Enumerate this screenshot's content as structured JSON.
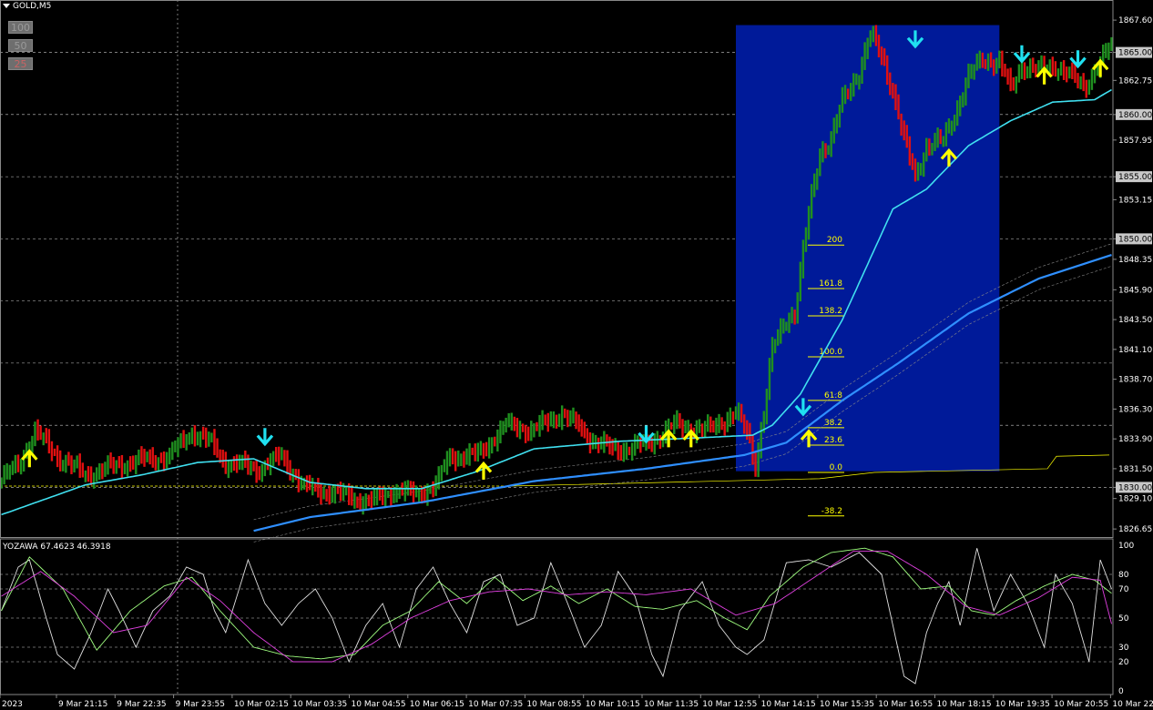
{
  "symbol_label": "GOLD,M5",
  "zoom_buttons": [
    {
      "label": "100",
      "color": "#9a9a9a",
      "bg": "#6e6e6e"
    },
    {
      "label": "50",
      "color": "#9a9a9a",
      "bg": "#6e6e6e"
    },
    {
      "label": "25",
      "color": "#c86464",
      "bg": "#6e6e6e"
    }
  ],
  "colors": {
    "background": "#000000",
    "bull": "#1f8f1f",
    "bear": "#e01010",
    "ma_fast": "#40e0f0",
    "ma_slow": "#2f8fff",
    "fib_box": "#001a99",
    "fib_line": "#ffff00",
    "buy_arrow": "#ffff00",
    "sell_arrow": "#20e0f0",
    "grid": "#c8c8c8"
  },
  "chart_data": [
    {
      "type": "candlestick",
      "symbol": "GOLD",
      "timeframe": "M5",
      "ylim": [
        1826.0,
        1869.0
      ],
      "price_ticks": [
        "1867.60",
        "1865.00",
        "1862.75",
        "1860.00",
        "1857.95",
        "1855.00",
        "1853.15",
        "1850.00",
        "1848.35",
        "1845.90",
        "1843.50",
        "1841.10",
        "1838.70",
        "1836.30",
        "1833.90",
        "1831.50",
        "1830.00",
        "1829.10",
        "1826.65"
      ],
      "highlighted_levels": [
        "1865.00",
        "1860.00",
        "1855.00",
        "1850.00",
        "1845.00",
        "1840.00",
        "1835.00",
        "1830.00"
      ],
      "time_ticks": [
        "2023",
        "9 Mar 21:15",
        "9 Mar 22:35",
        "9 Mar 23:55",
        "10 Mar 02:15",
        "10 Mar 03:35",
        "10 Mar 04:55",
        "10 Mar 06:15",
        "10 Mar 07:35",
        "10 Mar 08:55",
        "10 Mar 10:15",
        "10 Mar 11:35",
        "10 Mar 12:55",
        "10 Mar 14:15",
        "10 Mar 15:35",
        "10 Mar 16:55",
        "10 Mar 18:15",
        "10 Mar 19:35",
        "10 Mar 20:55",
        "10 Mar 22:15"
      ],
      "price_keypoints": [
        [
          0,
          1830.6
        ],
        [
          6,
          1831.8
        ],
        [
          12,
          1834.5
        ],
        [
          20,
          1832.5
        ],
        [
          30,
          1831.0
        ],
        [
          45,
          1832.0
        ],
        [
          60,
          1832.5
        ],
        [
          68,
          1834.5
        ],
        [
          75,
          1833.5
        ],
        [
          80,
          1832.0
        ],
        [
          92,
          1831.5
        ],
        [
          100,
          1832.5
        ],
        [
          108,
          1830.0
        ],
        [
          118,
          1829.6
        ],
        [
          132,
          1828.8
        ],
        [
          140,
          1829.8
        ],
        [
          148,
          1829.4
        ],
        [
          155,
          1830.2
        ],
        [
          160,
          1832.5
        ],
        [
          170,
          1832.6
        ],
        [
          180,
          1835.0
        ],
        [
          190,
          1834.6
        ],
        [
          200,
          1836.0
        ],
        [
          210,
          1834.0
        ],
        [
          218,
          1833.0
        ],
        [
          230,
          1833.4
        ],
        [
          240,
          1835.0
        ],
        [
          252,
          1834.6
        ],
        [
          262,
          1836.0
        ],
        [
          266,
          1834.4
        ],
        [
          269,
          1831.9
        ],
        [
          272,
          1836.0
        ],
        [
          275,
          1841.0
        ],
        [
          280,
          1843.6
        ],
        [
          283,
          1844.1
        ],
        [
          288,
          1852.0
        ],
        [
          292,
          1857.0
        ],
        [
          296,
          1858.0
        ],
        [
          300,
          1861.0
        ],
        [
          306,
          1863.5
        ],
        [
          310,
          1866.4
        ],
        [
          314,
          1864.7
        ],
        [
          318,
          1862.0
        ],
        [
          322,
          1858.0
        ],
        [
          326,
          1855.0
        ],
        [
          330,
          1857.5
        ],
        [
          336,
          1857.9
        ],
        [
          340,
          1860.0
        ],
        [
          345,
          1863.0
        ],
        [
          350,
          1864.5
        ],
        [
          356,
          1864.2
        ],
        [
          360,
          1862.0
        ],
        [
          364,
          1864.0
        ],
        [
          370,
          1863.5
        ],
        [
          376,
          1864.0
        ],
        [
          382,
          1863.0
        ],
        [
          386,
          1862.2
        ],
        [
          390,
          1863.6
        ],
        [
          396,
          1865.5
        ]
      ],
      "ma_fast_keypoints": [
        [
          0,
          1827.8
        ],
        [
          30,
          1830.2
        ],
        [
          50,
          1831.0
        ],
        [
          70,
          1832.0
        ],
        [
          90,
          1832.3
        ],
        [
          110,
          1830.4
        ],
        [
          130,
          1829.9
        ],
        [
          150,
          1829.9
        ],
        [
          170,
          1831.3
        ],
        [
          190,
          1833.1
        ],
        [
          220,
          1833.7
        ],
        [
          250,
          1834.0
        ],
        [
          268,
          1834.2
        ],
        [
          275,
          1835.0
        ],
        [
          285,
          1837.5
        ],
        [
          300,
          1843.5
        ],
        [
          318,
          1852.4
        ],
        [
          330,
          1854.0
        ],
        [
          345,
          1857.5
        ],
        [
          360,
          1859.5
        ],
        [
          375,
          1861.0
        ],
        [
          390,
          1861.2
        ],
        [
          396,
          1862.0
        ]
      ],
      "ma_slow_keypoints": [
        [
          90,
          1826.5
        ],
        [
          110,
          1827.6
        ],
        [
          150,
          1828.8
        ],
        [
          190,
          1830.5
        ],
        [
          230,
          1831.5
        ],
        [
          265,
          1832.6
        ],
        [
          280,
          1833.6
        ],
        [
          300,
          1837.0
        ],
        [
          320,
          1840.0
        ],
        [
          345,
          1844.0
        ],
        [
          370,
          1846.8
        ],
        [
          396,
          1848.7
        ]
      ],
      "signals_buy": [
        [
          10,
          1832.4
        ],
        [
          172,
          1831.4
        ],
        [
          238,
          1834.0
        ],
        [
          246,
          1834.0
        ],
        [
          288,
          1834.0
        ],
        [
          338,
          1856.6
        ],
        [
          372,
          1863.2
        ],
        [
          392,
          1863.8
        ]
      ],
      "signals_sell": [
        [
          94,
          1834.0
        ],
        [
          230,
          1834.2
        ],
        [
          286,
          1836.4
        ],
        [
          326,
          1866.0
        ],
        [
          364,
          1864.8
        ],
        [
          384,
          1864.4
        ]
      ],
      "fib_levels": [
        {
          "label": "200",
          "price": 1849.5
        },
        {
          "label": "161.8",
          "price": 1846.0
        },
        {
          "label": "138.2",
          "price": 1843.8
        },
        {
          "label": "100.0",
          "price": 1840.5
        },
        {
          "label": "61.8",
          "price": 1837.0
        },
        {
          "label": "38.2",
          "price": 1834.8
        },
        {
          "label": "23.6",
          "price": 1833.4
        },
        {
          "label": "0.0",
          "price": 1831.2
        },
        {
          "label": "-38.2",
          "price": 1827.7
        }
      ],
      "fib_zone": {
        "start_bar": 262,
        "end_bar": 356,
        "price_high": 1867.2,
        "price_low": 1831.3
      }
    },
    {
      "type": "line",
      "indicator_label": "YOZAWA 67.4623 46.3918",
      "ylim": [
        0,
        100
      ],
      "y_ticks": [
        "100",
        "80",
        "70",
        "50",
        "30",
        "20",
        "0"
      ],
      "series": [
        {
          "color": "#e0e0e0",
          "keypoints": [
            [
              0,
              55
            ],
            [
              6,
              85
            ],
            [
              10,
              90
            ],
            [
              16,
              50
            ],
            [
              20,
              25
            ],
            [
              26,
              15
            ],
            [
              32,
              40
            ],
            [
              38,
              70
            ],
            [
              42,
              55
            ],
            [
              48,
              30
            ],
            [
              54,
              55
            ],
            [
              60,
              65
            ],
            [
              66,
              85
            ],
            [
              72,
              80
            ],
            [
              76,
              55
            ],
            [
              80,
              40
            ],
            [
              88,
              90
            ],
            [
              94,
              60
            ],
            [
              100,
              45
            ],
            [
              106,
              60
            ],
            [
              112,
              70
            ],
            [
              118,
              50
            ],
            [
              124,
              20
            ],
            [
              130,
              45
            ],
            [
              136,
              60
            ],
            [
              142,
              30
            ],
            [
              148,
              70
            ],
            [
              154,
              85
            ],
            [
              160,
              60
            ],
            [
              166,
              40
            ],
            [
              172,
              75
            ],
            [
              178,
              80
            ],
            [
              184,
              45
            ],
            [
              190,
              50
            ],
            [
              196,
              88
            ],
            [
              202,
              60
            ],
            [
              208,
              30
            ],
            [
              214,
              45
            ],
            [
              220,
              82
            ],
            [
              226,
              65
            ],
            [
              232,
              25
            ],
            [
              236,
              10
            ],
            [
              242,
              55
            ],
            [
              250,
              75
            ],
            [
              256,
              45
            ],
            [
              262,
              30
            ],
            [
              266,
              25
            ],
            [
              272,
              35
            ],
            [
              280,
              88
            ],
            [
              288,
              90
            ],
            [
              296,
              85
            ],
            [
              306,
              95
            ],
            [
              314,
              80
            ],
            [
              322,
              10
            ],
            [
              326,
              5
            ],
            [
              330,
              40
            ],
            [
              334,
              60
            ],
            [
              338,
              75
            ],
            [
              342,
              45
            ],
            [
              348,
              98
            ],
            [
              354,
              55
            ],
            [
              360,
              80
            ],
            [
              366,
              60
            ],
            [
              372,
              30
            ],
            [
              376,
              80
            ],
            [
              382,
              60
            ],
            [
              388,
              20
            ],
            [
              392,
              90
            ],
            [
              396,
              70
            ]
          ]
        },
        {
          "color": "#a0ff80",
          "keypoints": [
            [
              0,
              55
            ],
            [
              10,
              92
            ],
            [
              22,
              70
            ],
            [
              34,
              28
            ],
            [
              46,
              55
            ],
            [
              58,
              72
            ],
            [
              68,
              78
            ],
            [
              78,
              55
            ],
            [
              90,
              30
            ],
            [
              102,
              24
            ],
            [
              114,
              22
            ],
            [
              126,
              25
            ],
            [
              136,
              45
            ],
            [
              146,
              55
            ],
            [
              156,
              75
            ],
            [
              166,
              60
            ],
            [
              176,
              78
            ],
            [
              186,
              62
            ],
            [
              196,
              72
            ],
            [
              206,
              60
            ],
            [
              216,
              70
            ],
            [
              226,
              58
            ],
            [
              236,
              56
            ],
            [
              248,
              62
            ],
            [
              258,
              50
            ],
            [
              266,
              42
            ],
            [
              274,
              65
            ],
            [
              286,
              85
            ],
            [
              296,
              95
            ],
            [
              308,
              98
            ],
            [
              318,
              92
            ],
            [
              328,
              70
            ],
            [
              338,
              72
            ],
            [
              346,
              55
            ],
            [
              354,
              52
            ],
            [
              362,
              62
            ],
            [
              372,
              72
            ],
            [
              382,
              80
            ],
            [
              390,
              76
            ],
            [
              396,
              67
            ]
          ]
        },
        {
          "color": "#e040e0",
          "keypoints": [
            [
              0,
              65
            ],
            [
              14,
              82
            ],
            [
              26,
              65
            ],
            [
              40,
              40
            ],
            [
              52,
              45
            ],
            [
              66,
              78
            ],
            [
              78,
              62
            ],
            [
              90,
              40
            ],
            [
              104,
              20
            ],
            [
              118,
              20
            ],
            [
              132,
              32
            ],
            [
              146,
              50
            ],
            [
              160,
              62
            ],
            [
              174,
              68
            ],
            [
              188,
              70
            ],
            [
              202,
              66
            ],
            [
              216,
              68
            ],
            [
              230,
              66
            ],
            [
              246,
              70
            ],
            [
              262,
              52
            ],
            [
              276,
              60
            ],
            [
              290,
              78
            ],
            [
              304,
              96
            ],
            [
              316,
              96
            ],
            [
              330,
              80
            ],
            [
              344,
              58
            ],
            [
              356,
              52
            ],
            [
              370,
              64
            ],
            [
              382,
              78
            ],
            [
              392,
              76
            ],
            [
              396,
              46
            ]
          ]
        }
      ]
    }
  ]
}
